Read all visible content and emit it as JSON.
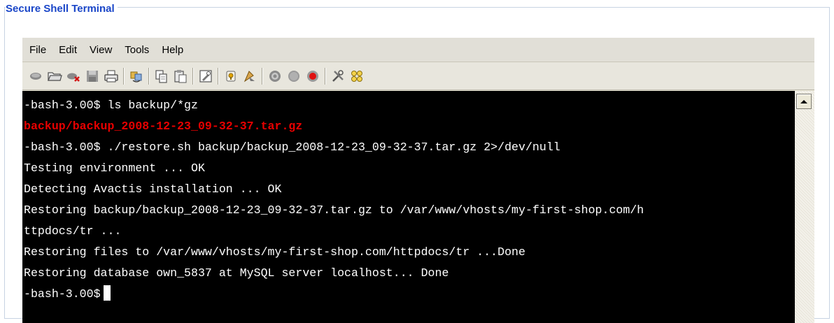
{
  "panel": {
    "title": "Secure Shell Terminal"
  },
  "menu": [
    "File",
    "Edit",
    "View",
    "Tools",
    "Help"
  ],
  "toolbar": [
    "connect-icon",
    "open-folder-icon",
    "disconnect-icon",
    "save-icon",
    "print-icon",
    "separator",
    "reconnect-icon",
    "separator",
    "copy-icon",
    "paste-icon",
    "separator",
    "settings-icon",
    "separator",
    "key-icon",
    "transfer-icon",
    "separator",
    "record-icon",
    "pause-icon",
    "stop-icon",
    "separator",
    "tools-icon",
    "options-icon"
  ],
  "terminal": {
    "lines": [
      {
        "text": "-bash-3.00$ ls backup/*gz",
        "color": "#ffffff"
      },
      {
        "text": "backup/backup_2008-12-23_09-32-37.tar.gz",
        "color": "#e60000"
      },
      {
        "text": "-bash-3.00$ ./restore.sh backup/backup_2008-12-23_09-32-37.tar.gz 2>/dev/null",
        "color": "#ffffff"
      },
      {
        "text": "Testing environment ... OK",
        "color": "#ffffff"
      },
      {
        "text": "Detecting Avactis installation ... OK",
        "color": "#ffffff"
      },
      {
        "text": "Restoring backup/backup_2008-12-23_09-32-37.tar.gz to /var/www/vhosts/my-first-shop.com/h",
        "color": "#ffffff"
      },
      {
        "text": "ttpdocs/tr ...",
        "color": "#ffffff"
      },
      {
        "text": "Restoring files to /var/www/vhosts/my-first-shop.com/httpdocs/tr ...Done",
        "color": "#ffffff"
      },
      {
        "text": "Restoring database own_5837 at MySQL server localhost... Done",
        "color": "#ffffff"
      }
    ],
    "prompt": "-bash-3.00$"
  },
  "colors": {
    "legend": "#1a46c8",
    "terminal_bg": "#000000",
    "highlight": "#e60000"
  }
}
